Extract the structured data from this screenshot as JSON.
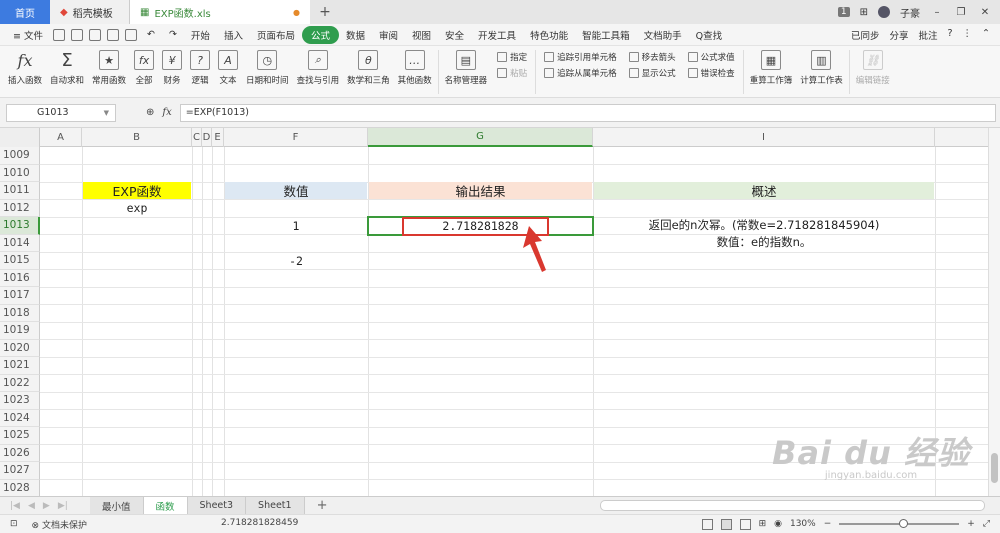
{
  "titlebar": {
    "tabs": [
      {
        "label": "首页"
      },
      {
        "label": "稻壳模板"
      },
      {
        "label": "EXP函数.xls"
      }
    ],
    "page_num": "1",
    "user": "子豪"
  },
  "menubar": {
    "file": "≡ 文件",
    "items": [
      "开始",
      "插入",
      "页面布局",
      "公式",
      "数据",
      "审阅",
      "视图",
      "安全",
      "开发工具",
      "特色功能",
      "智能工具箱",
      "文档助手"
    ],
    "search": "Q查找",
    "right": [
      "已同步",
      "分享",
      "批注"
    ]
  },
  "ribbon": {
    "buttons": [
      "插入函数",
      "自动求和",
      "常用函数",
      "全部",
      "财务",
      "逻辑",
      "文本",
      "日期和时间",
      "查找与引用",
      "数学和三角",
      "其他函数"
    ],
    "name_manager": "名称管理器",
    "specify": "指定",
    "paste": "粘贴",
    "trace_precedents": "追踪引用单元格",
    "trace_dependents": "追踪从属单元格",
    "remove_arrows": "移去箭头",
    "show_formulas": "显示公式",
    "evaluate": "公式求值",
    "error_check": "错误检查",
    "recalc_book": "重算工作簿",
    "calc_sheet": "计算工作表",
    "edit_links": "编辑链接"
  },
  "formulabar": {
    "cell_ref": "G1013",
    "formula": "=EXP(F1013)"
  },
  "grid": {
    "columns": [
      "A",
      "B",
      "C",
      "D",
      "E",
      "F",
      "G",
      "I"
    ],
    "rows": [
      "1009",
      "1010",
      "1011",
      "1012",
      "1013",
      "1014",
      "1015",
      "1016",
      "1017",
      "1018",
      "1019",
      "1020",
      "1021",
      "1022",
      "1023",
      "1024",
      "1025",
      "1026",
      "1027",
      "1028"
    ],
    "selected_row": "1013",
    "selected_col": "G",
    "cells": {
      "b1011": "EXP函数",
      "b1012": "exp",
      "f1011": "数值",
      "g1011": "输出结果",
      "i1011": "概述",
      "f1013": "1",
      "g1013": "2.718281828",
      "f1015": "-2",
      "i1013_line1": "返回e的n次幂。(常数e=2.718281845904)",
      "i1013_line2": "数值：e的指数n。"
    }
  },
  "watermark": {
    "logo": "Bai du 经验",
    "url": "jingyan.baidu.com"
  },
  "sheets": {
    "tabs": [
      "最小值",
      "函数",
      "Sheet3",
      "Sheet1"
    ],
    "active": "函数",
    "add": "+"
  },
  "statusbar": {
    "protect": "文档未保护",
    "sum": "2.718281828459",
    "zoom": "130%"
  },
  "colors": {
    "accent_green": "#2f9d4e",
    "highlight_yellow": "#ffff00",
    "header_blue": "#dde8f3",
    "header_peach": "#fbe2d5",
    "header_green": "#e2efdb",
    "callout_red": "#d9382f"
  }
}
